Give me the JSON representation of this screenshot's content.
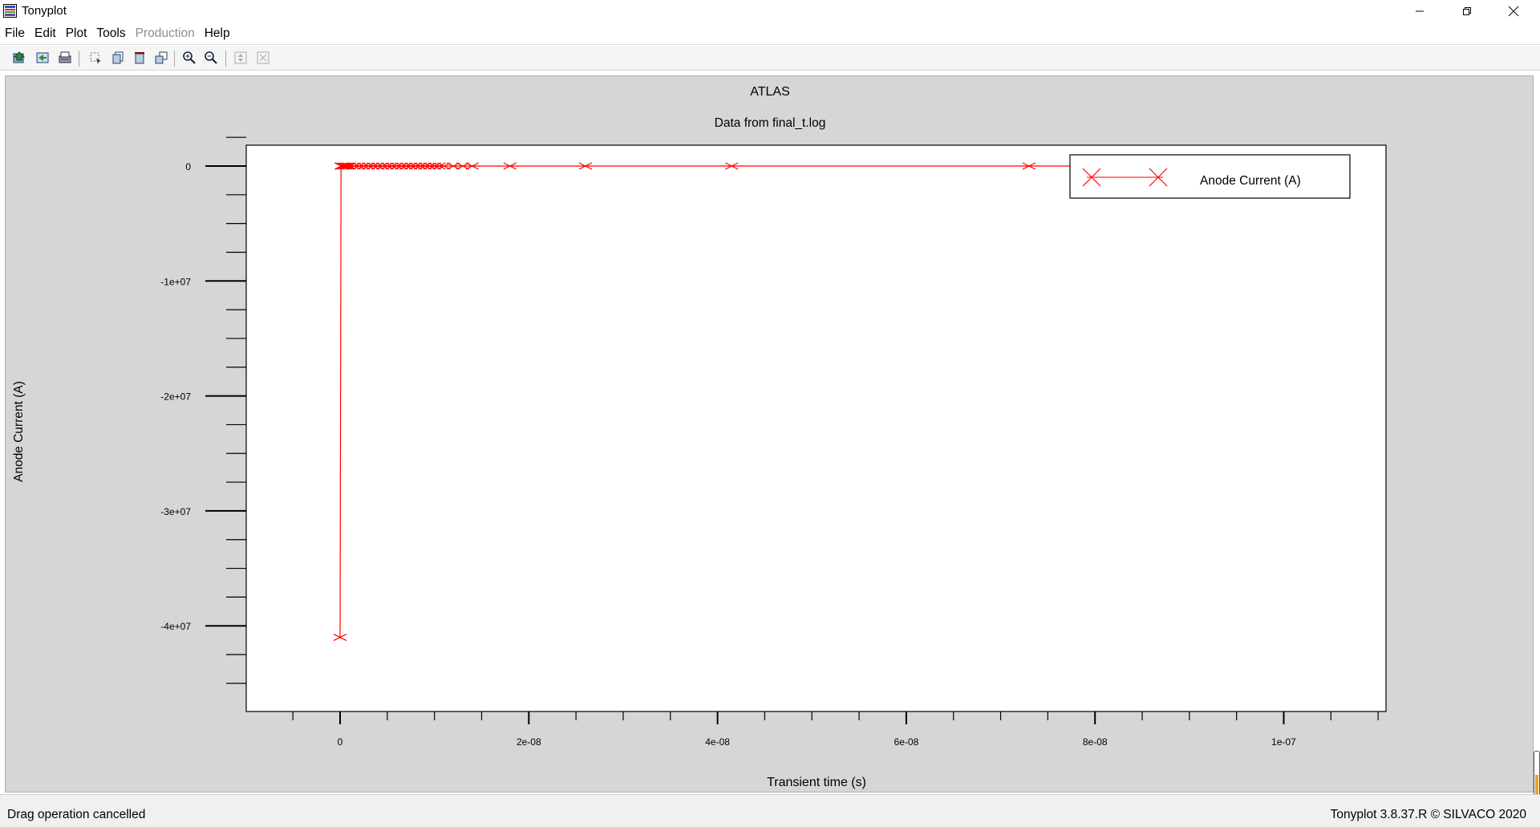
{
  "window": {
    "title": "Tonyplot",
    "controls": [
      "minimize",
      "restore",
      "close"
    ]
  },
  "menubar": {
    "items": [
      {
        "label": "File",
        "enabled": true
      },
      {
        "label": "Edit",
        "enabled": true
      },
      {
        "label": "Plot",
        "enabled": true
      },
      {
        "label": "Tools",
        "enabled": true
      },
      {
        "label": "Production",
        "enabled": false
      },
      {
        "label": "Help",
        "enabled": true
      }
    ]
  },
  "toolbar": {
    "icons": [
      "load-icon",
      "import-icon",
      "print-icon",
      "select-icon",
      "copy-icon",
      "delete-icon",
      "duplicate-icon",
      "zoom-in-icon",
      "zoom-out-icon",
      "pan-icon",
      "reset-icon"
    ]
  },
  "chart_data": {
    "type": "line",
    "title": "ATLAS",
    "subtitle": "Data from final_t.log",
    "xlabel": "Transient time (s)",
    "ylabel": "Anode Current (A)",
    "xlim": [
      -5e-09,
      1.1e-07
    ],
    "ylim": [
      -45000000.0,
      4500000.0
    ],
    "x_ticks": [
      0,
      2e-08,
      4e-08,
      6e-08,
      8e-08,
      1e-07
    ],
    "x_tick_labels": [
      "0",
      "2e-08",
      "4e-08",
      "6e-08",
      "8e-08",
      "1e-07"
    ],
    "y_ticks": [
      0,
      -10000000.0,
      -20000000.0,
      -30000000.0,
      -40000000.0
    ],
    "y_tick_labels": [
      "0",
      "-1e+07",
      "-2e+07",
      "-3e+07",
      "-4e+07"
    ],
    "grid": false,
    "legend_position": "top-right",
    "marker": "x",
    "color": "#ff0000",
    "series": [
      {
        "name": "Anode Current (A)",
        "x": [
          0,
          1e-10,
          2e-10,
          4e-10,
          6e-10,
          8e-10,
          1e-09,
          1.5e-09,
          2e-09,
          2.5e-09,
          3e-09,
          3.5e-09,
          4e-09,
          4.5e-09,
          5e-09,
          5.5e-09,
          6e-09,
          6.5e-09,
          7e-09,
          7.5e-09,
          8e-09,
          8.5e-09,
          9e-09,
          9.5e-09,
          1e-08,
          1.05e-08,
          1.1e-08,
          1.2e-08,
          1.3e-08,
          1.4e-08,
          1.8e-08,
          2.6e-08,
          4.15e-08,
          7.3e-08,
          1e-07
        ],
        "y": [
          -41000000.0,
          0,
          0,
          0,
          0,
          0,
          0,
          0,
          0,
          0,
          0,
          0,
          0,
          0,
          0,
          0,
          0,
          0,
          0,
          0,
          0,
          0,
          0,
          0,
          0,
          0,
          0,
          0,
          0,
          0,
          0,
          0,
          0,
          0,
          0
        ]
      }
    ]
  },
  "statusbar": {
    "message": "Drag operation cancelled",
    "version": "Tonyplot 3.8.37.R © SILVACO 2020"
  }
}
